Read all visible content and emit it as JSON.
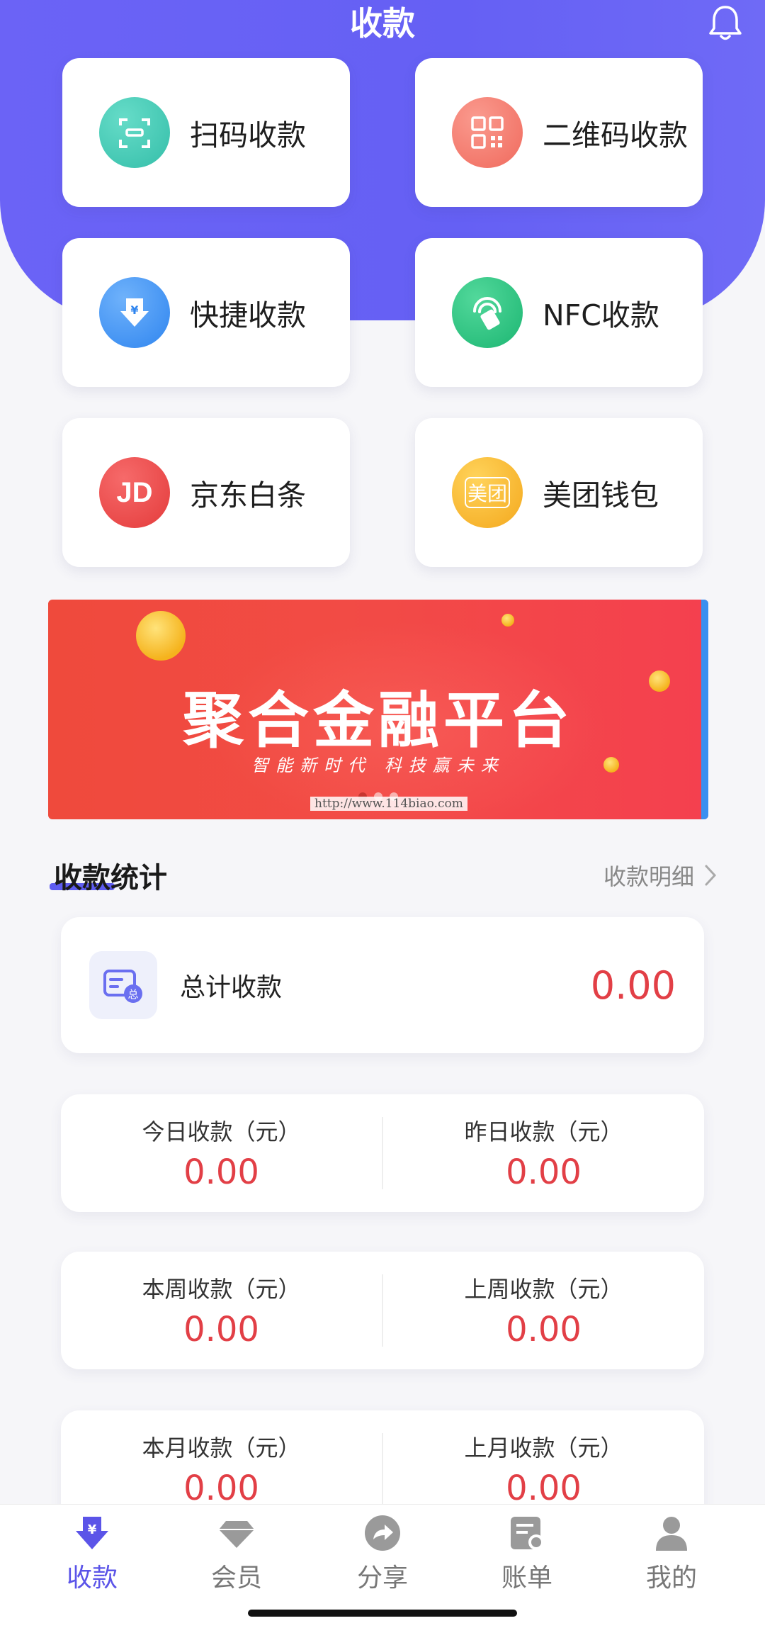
{
  "header": {
    "title": "收款"
  },
  "tiles": [
    {
      "label": "扫码收款",
      "icon": "scan-icon",
      "color": "#3fc6b4"
    },
    {
      "label": "二维码收款",
      "icon": "qrcode-icon",
      "color": "#f3786c"
    },
    {
      "label": "快捷收款",
      "icon": "quick-pay-icon",
      "color": "#3e8ff3"
    },
    {
      "label": "NFC收款",
      "icon": "nfc-icon",
      "color": "#28c17f"
    },
    {
      "label": "京东白条",
      "icon": "jd-icon",
      "color": "#ea4545",
      "icon_text": "JD"
    },
    {
      "label": "美团钱包",
      "icon": "meituan-icon",
      "color": "#f7b52c",
      "icon_text": "美团"
    }
  ],
  "banner": {
    "title": "聚合金融平台",
    "subtitle": "智能新时代 科技赢未来",
    "watermark": "http://www.114biao.com"
  },
  "stats": {
    "title": "收款统计",
    "detail_link": "收款明细",
    "total": {
      "label": "总计收款",
      "value": "0.00"
    },
    "pairs": [
      [
        {
          "label": "今日收款（元）",
          "value": "0.00"
        },
        {
          "label": "昨日收款（元）",
          "value": "0.00"
        }
      ],
      [
        {
          "label": "本周收款（元）",
          "value": "0.00"
        },
        {
          "label": "上周收款（元）",
          "value": "0.00"
        }
      ],
      [
        {
          "label": "本月收款（元）",
          "value": "0.00"
        },
        {
          "label": "上月收款（元）",
          "value": "0.00"
        }
      ]
    ]
  },
  "tabbar": {
    "items": [
      {
        "label": "收款",
        "icon": "collect-icon",
        "active": true
      },
      {
        "label": "会员",
        "icon": "member-diamond-icon",
        "active": false
      },
      {
        "label": "分享",
        "icon": "share-icon",
        "active": false
      },
      {
        "label": "账单",
        "icon": "bill-icon",
        "active": false
      },
      {
        "label": "我的",
        "icon": "profile-icon",
        "active": false
      }
    ]
  },
  "colors": {
    "primary": "#6561f4",
    "amount": "#e23f46",
    "banner": "#f24b45"
  }
}
